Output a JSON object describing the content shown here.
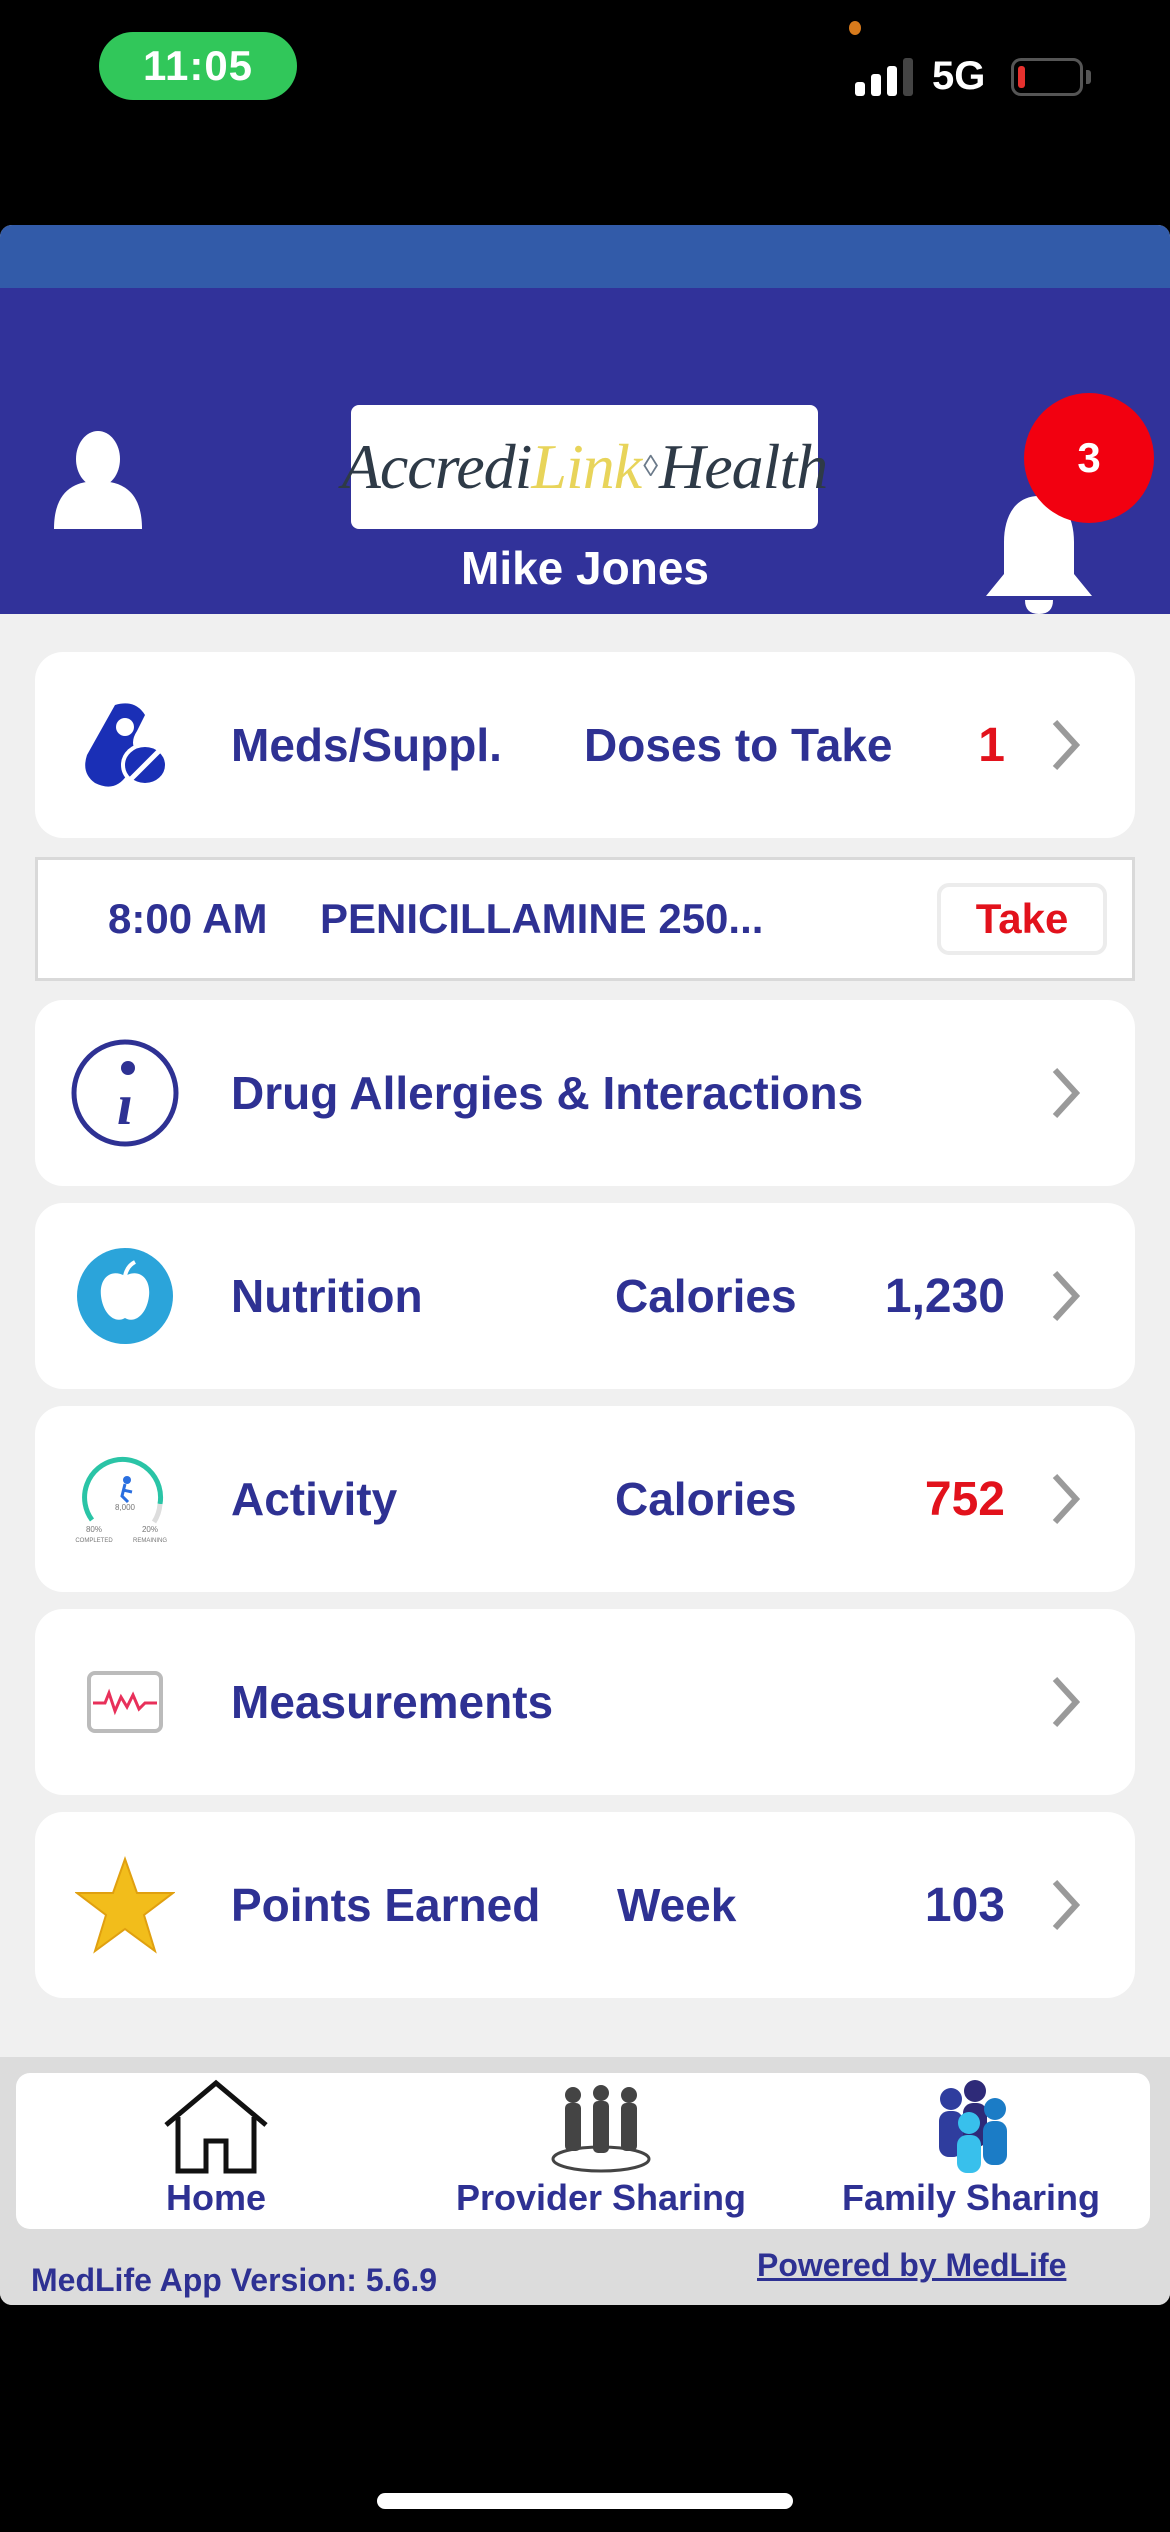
{
  "status_bar": {
    "time": "11:05",
    "network": "5G",
    "battery_level_percent": 10
  },
  "header": {
    "logo": {
      "part1": "Accredi",
      "part2": "Link",
      "part3": "Health"
    },
    "user_name": "Mike Jones",
    "notification_count": "3"
  },
  "colors": {
    "primary": "#31329a",
    "accent_strip": "#325ba9",
    "text": "#2e3193",
    "alert": "#e2121c",
    "badge": "#f20010"
  },
  "cards": {
    "meds": {
      "title": "Meds/Suppl.",
      "metric_label": "Doses to Take",
      "metric_value": "1",
      "icon": "pill-capsule-icon"
    },
    "allergies": {
      "title": "Drug Allergies & Interactions",
      "icon": "info-icon"
    },
    "nutrition": {
      "title": "Nutrition",
      "metric_label": "Calories",
      "metric_value": "1,230",
      "icon": "apple-icon"
    },
    "activity": {
      "title": "Activity",
      "metric_label": "Calories",
      "metric_value": "752",
      "icon": "activity-gauge-icon",
      "gauge": {
        "center": "8,000",
        "completed_pct": "80%",
        "completed_label": "COMPLETED",
        "remaining_pct": "20%",
        "remaining_label": "REMAINING",
        "progress": 0.8
      }
    },
    "measurements": {
      "title": "Measurements",
      "icon": "heart-monitor-icon"
    },
    "points": {
      "title": "Points Earned",
      "metric_label": "Week",
      "metric_value": "103",
      "icon": "star-icon"
    }
  },
  "dose": {
    "time": "8:00 AM",
    "medication": "PENICILLAMINE 250...",
    "action_label": "Take"
  },
  "bottom_nav": {
    "items": [
      {
        "label": "Home",
        "icon": "home-icon"
      },
      {
        "label": "Provider Sharing",
        "icon": "provider-group-icon"
      },
      {
        "label": "Family Sharing",
        "icon": "family-icon"
      }
    ]
  },
  "footer": {
    "version": "MedLife App Version: 5.6.9",
    "powered_by": "Powered by MedLife"
  }
}
